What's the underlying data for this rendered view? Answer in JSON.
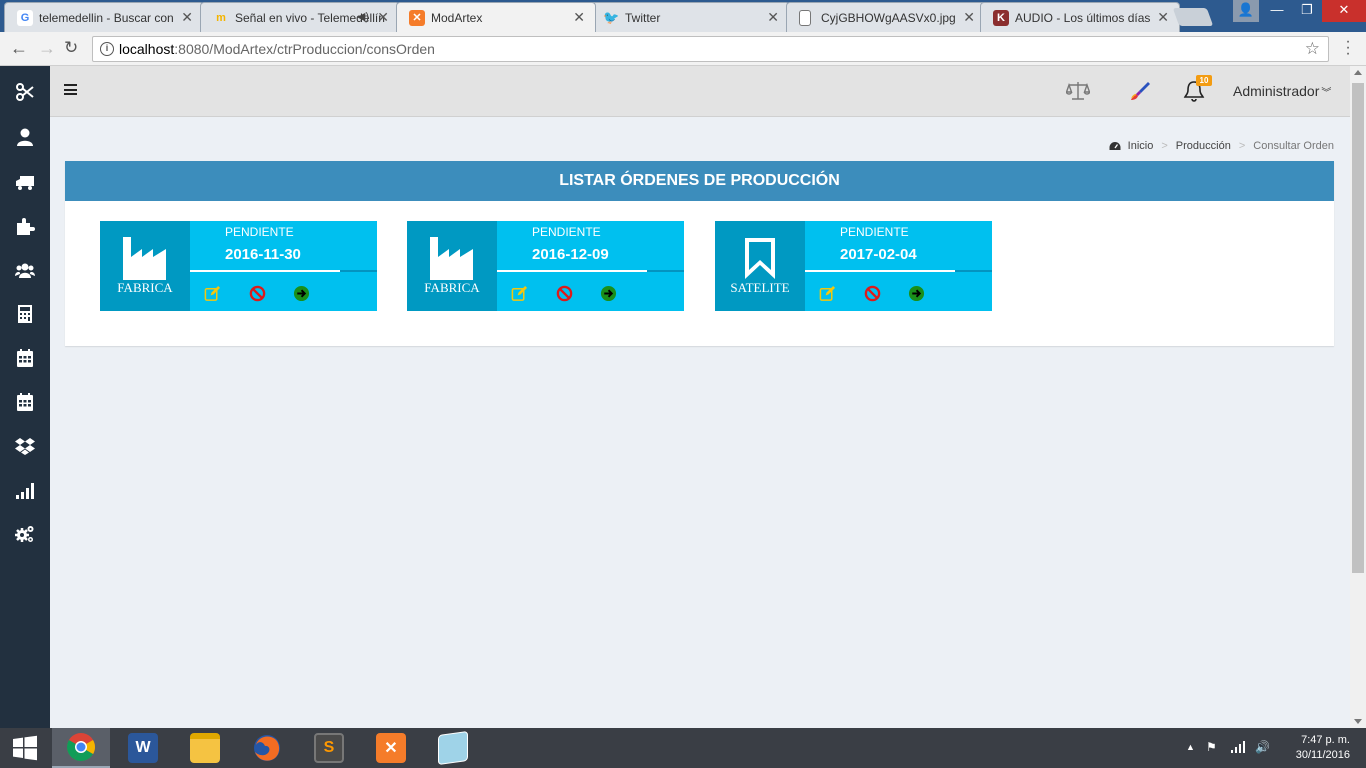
{
  "browser": {
    "tabs": [
      {
        "title": "telemedellin - Buscar con",
        "icon": "google-g-icon"
      },
      {
        "title": "Señal en vivo - Telemedellín",
        "icon": "telemedellin-m-icon"
      },
      {
        "title": "ModArtex",
        "icon": "xampp-icon"
      },
      {
        "title": "Twitter",
        "icon": "twitter-bird-icon"
      },
      {
        "title": "CyjGBHOWgAASVx0.jpg",
        "icon": "file-icon"
      },
      {
        "title": "AUDIO - Los últimos días",
        "icon": "k-icon"
      }
    ],
    "url_host": "localhost",
    "url_rest": ":8080/ModArtex/ctrProduccion/consOrden"
  },
  "sidebar": {
    "items": [
      "scissors-icon",
      "user-icon",
      "truck-icon",
      "puzzle-icon",
      "users-icon",
      "calculator-icon",
      "calendar-icon",
      "calendar-alt-icon",
      "dropbox-icon",
      "signal-icon",
      "cogs-icon"
    ]
  },
  "header": {
    "notification_count": "10",
    "user_label": "Administrador",
    "user_chevron": "»"
  },
  "breadcrumb": {
    "home": "Inicio",
    "section": "Producción",
    "current": "Consultar Orden",
    "separator": ">"
  },
  "panel": {
    "title": "LISTAR ÓRDENES DE PRODUCCIÓN"
  },
  "orders": [
    {
      "status": "PENDIENTE",
      "date": "2016-11-30",
      "type": "FABRICA",
      "icon": "industry-icon"
    },
    {
      "status": "PENDIENTE",
      "date": "2016-12-09",
      "type": "FABRICA",
      "icon": "industry-icon"
    },
    {
      "status": "PENDIENTE",
      "date": "2017-02-04",
      "type": "SATELITE",
      "icon": "bookmark-icon"
    }
  ],
  "colors": {
    "panel_header": "#3c8dbc",
    "card_bg": "#00c0ef",
    "card_side": "#0099c2",
    "sidebar": "#22303f",
    "edit": "#f3c70f",
    "cancel": "#dd1a1a",
    "go": "#1a8f1a"
  },
  "taskbar": {
    "apps": [
      "chrome-icon",
      "word-icon",
      "file-explorer-icon",
      "firefox-icon",
      "sublime-text-icon",
      "xampp-icon",
      "notepad-icon"
    ],
    "time": "7:47 p. m.",
    "date": "30/11/2016"
  }
}
